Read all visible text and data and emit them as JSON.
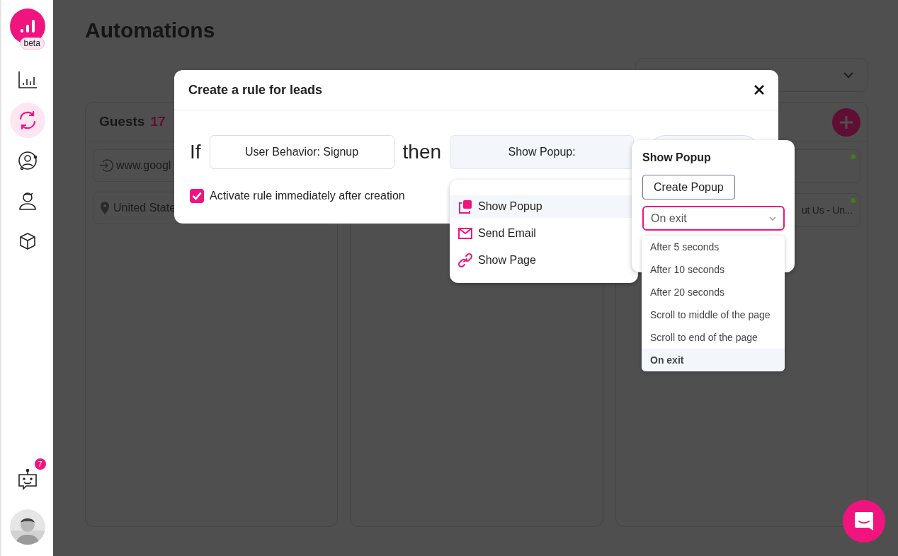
{
  "sidebar": {
    "logo_badge": "beta",
    "nav_items": [
      {
        "selected": false
      },
      {
        "selected": true
      },
      {
        "selected": false
      },
      {
        "selected": false
      },
      {
        "selected": false
      }
    ],
    "bot_badge": "7"
  },
  "page": {
    "title": "Automations"
  },
  "guests_column": {
    "title": "Guests",
    "count": "17",
    "items": [
      {
        "kind": "referrer",
        "text": "www.googl"
      },
      {
        "kind": "location",
        "text": "United State"
      }
    ]
  },
  "third_column": {
    "items": [
      {
        "color": "#3f7d1c"
      },
      {
        "text": "ut Us - Un...",
        "color": "#3f7d1c"
      }
    ]
  },
  "modal": {
    "title": "Create a rule for leads",
    "if_label": "If",
    "condition": "User Behavior: Signup",
    "then_label": "then",
    "action": "Show Popup:",
    "activate": {
      "label": "Activate rule immediately after creation",
      "checked": true
    }
  },
  "action_menu": {
    "items": [
      {
        "label": "Show Popup",
        "selected": true
      },
      {
        "label": "Send Email",
        "selected": false
      },
      {
        "label": "Show Page",
        "selected": false
      }
    ]
  },
  "popover": {
    "title": "Show Popup",
    "create_button": "Create Popup",
    "trigger": {
      "value": "On exit",
      "options": [
        {
          "label": "After 5 seconds",
          "selected": false
        },
        {
          "label": "After 10 seconds",
          "selected": false
        },
        {
          "label": "After 20 seconds",
          "selected": false
        },
        {
          "label": "Scroll to middle of the page",
          "selected": false
        },
        {
          "label": "Scroll to end of the page",
          "selected": false
        },
        {
          "label": "On exit",
          "selected": true
        }
      ]
    }
  }
}
